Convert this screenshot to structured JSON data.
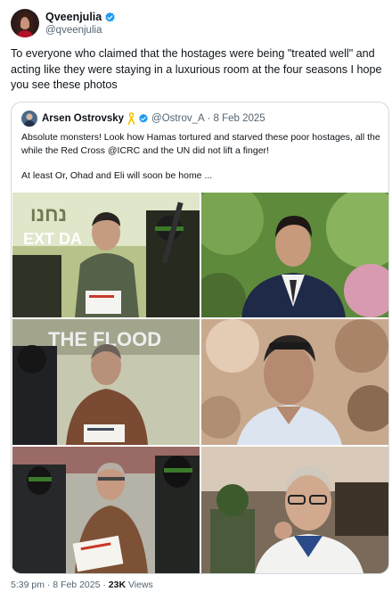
{
  "author": {
    "name": "Qveenjulia",
    "handle": "@qveenjulia",
    "verified_icon": "verified-badge-icon",
    "badge_color": "#1d9bf0"
  },
  "tweet": {
    "text": "To everyone who claimed that the hostages were being \"treated well\" and acting like they were staying in a luxurious room at the four seasons I hope you see these photos"
  },
  "quoted": {
    "name": "Arsen Ostrovsky",
    "emoji_icon": "yellow-ribbon-icon",
    "handle": "@Ostrov_A",
    "separator": "·",
    "date": "8 Feb 2025",
    "paragraph1": "Absolute monsters! Look how Hamas tortured and starved these poor hostages, all the while the Red Cross @ICRC and the UN did not lift a finger!",
    "paragraph2": "At least Or, Ohad and Eli will soon be home ...",
    "photos": [
      {
        "overlay_text": "נחנו"
      },
      {
        "overlay_text": ""
      },
      {
        "overlay_text": "THE FLOOD"
      },
      {
        "overlay_text": ""
      },
      {
        "overlay_text": ""
      },
      {
        "overlay_text": ""
      }
    ],
    "photo_caption_1": "EXT DA"
  },
  "meta": {
    "time": "5:39 pm",
    "sep1": "·",
    "date": "8 Feb 2025",
    "sep2": "·",
    "views_count": "23K",
    "views_label": "Views"
  }
}
